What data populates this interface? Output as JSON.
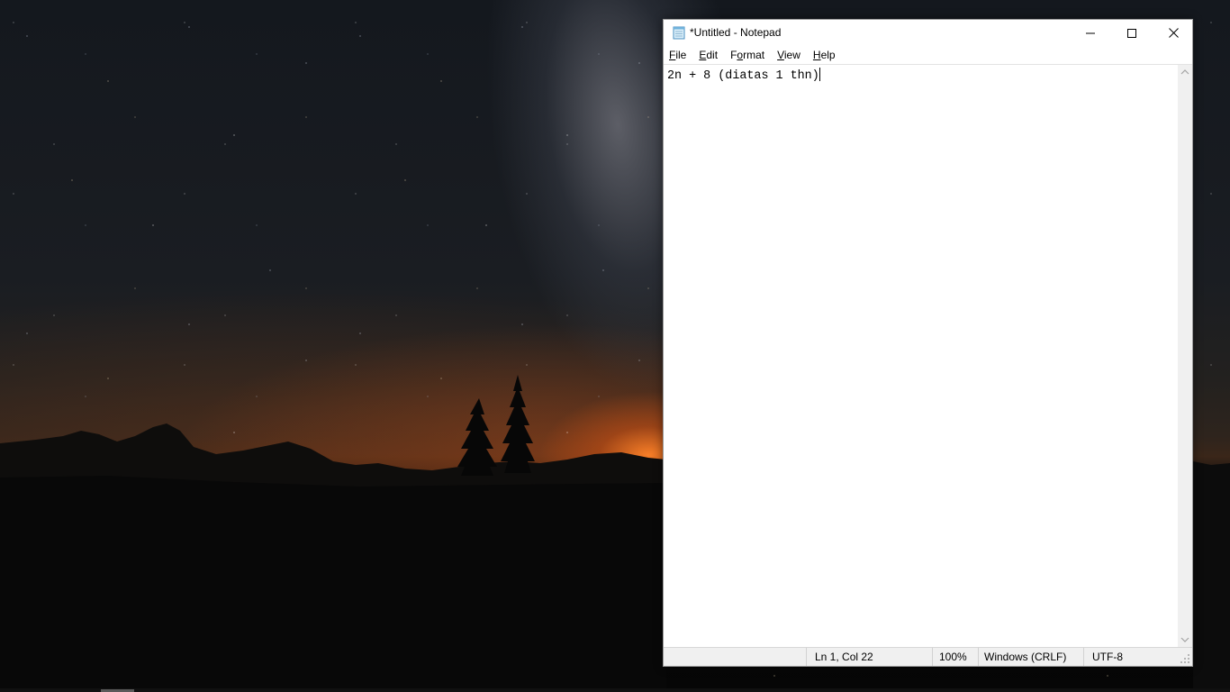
{
  "window": {
    "title": "*Untitled - Notepad",
    "app_icon": "notepad-icon",
    "controls": {
      "minimize_icon": "minimize-icon",
      "maximize_icon": "maximize-icon",
      "close_icon": "close-icon"
    }
  },
  "menu": {
    "items": [
      {
        "label": "File",
        "accel": "F"
      },
      {
        "label": "Edit",
        "accel": "E"
      },
      {
        "label": "Format",
        "accel": "o"
      },
      {
        "label": "View",
        "accel": "V"
      },
      {
        "label": "Help",
        "accel": "H"
      }
    ]
  },
  "editor": {
    "content": "2n + 8 (diatas 1 thn)"
  },
  "statusbar": {
    "position": "Ln 1, Col 22",
    "zoom": "100%",
    "line_ending": "Windows (CRLF)",
    "encoding": "UTF-8"
  },
  "colors": {
    "window_bg": "#ffffff",
    "statusbar_bg": "#f0f0f0",
    "horizon_glow": "#ff8228"
  }
}
